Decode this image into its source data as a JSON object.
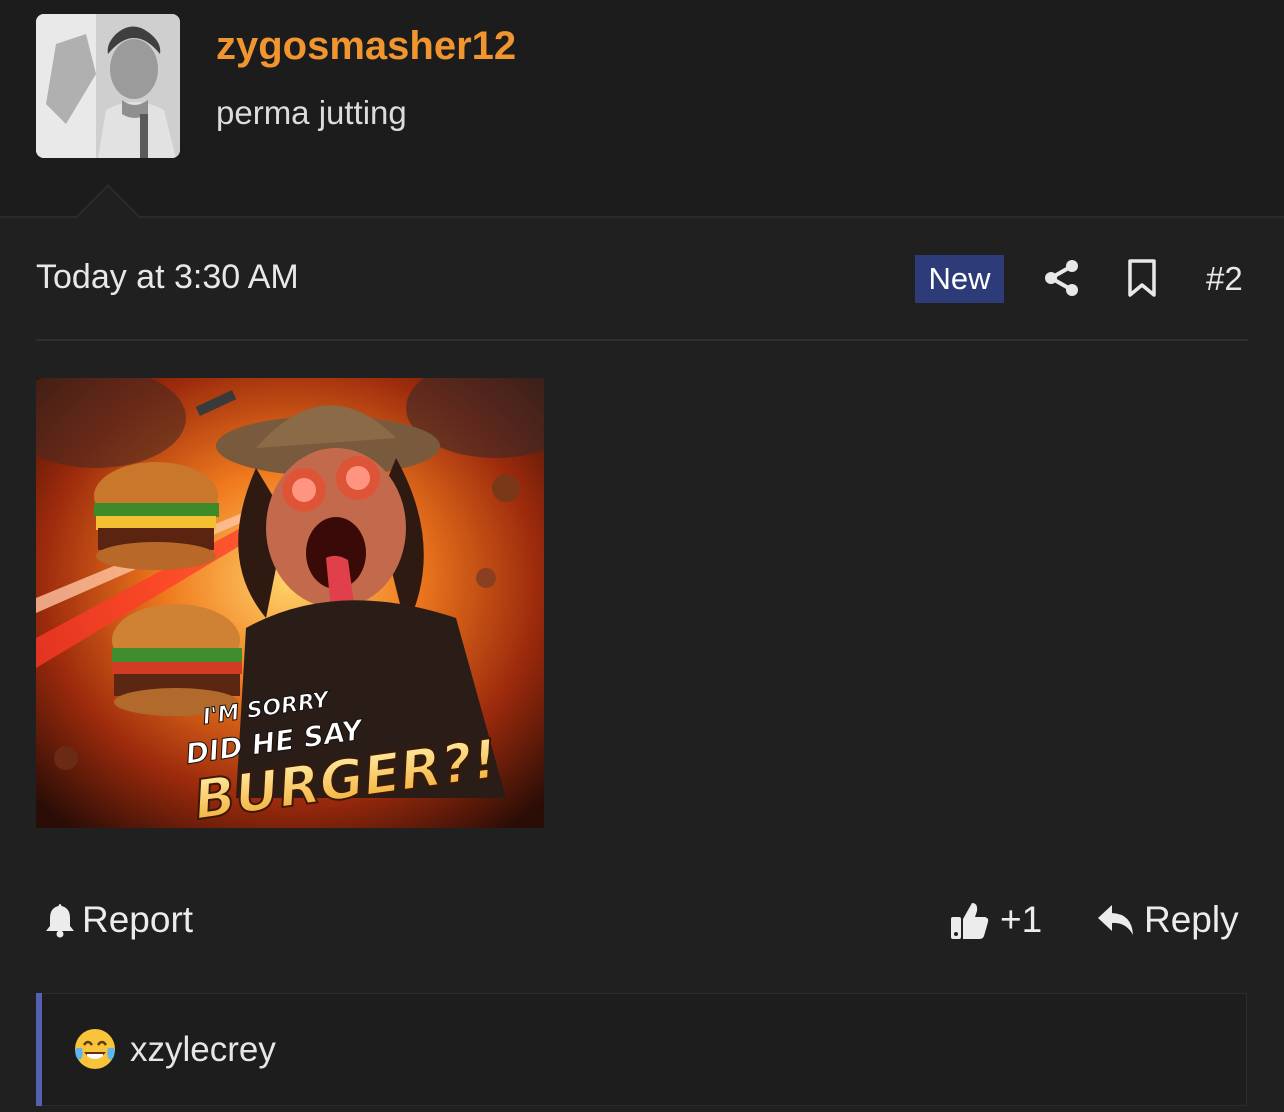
{
  "user": {
    "name": "zygosmasher12",
    "title": "perma jutting",
    "name_color": "#f0952f"
  },
  "post": {
    "date": "Today at 3:30 AM",
    "new_badge": "New",
    "number": "#2",
    "image_caption": {
      "line1": "I'M SORRY",
      "line2": "DID HE SAY",
      "line3": "BURGER?!"
    },
    "icons": [
      "share-icon",
      "bookmark-icon"
    ]
  },
  "actions": {
    "report": "Report",
    "like_count": "+1",
    "reply": "Reply"
  },
  "reactions": {
    "emoji": "face-with-tears-of-joy",
    "users": "xzylecrey"
  },
  "colors": {
    "background": "#202020",
    "badge": "#2d3b78",
    "accent_bar": "#5561b0"
  }
}
